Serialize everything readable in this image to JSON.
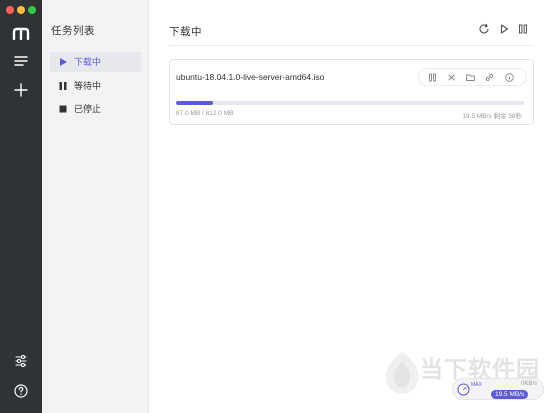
{
  "window": {
    "controls": [
      "close",
      "minimize",
      "maximize"
    ]
  },
  "rail": {
    "icons": [
      "app-logo-icon",
      "menu-icon",
      "add-icon",
      "preferences-icon",
      "help-icon"
    ]
  },
  "categories": {
    "title": "任务列表",
    "items": [
      {
        "label": "下载中",
        "icon": "play-icon",
        "active": true
      },
      {
        "label": "等待中",
        "icon": "pause-icon",
        "active": false
      },
      {
        "label": "已停止",
        "icon": "stop-icon",
        "active": false
      }
    ]
  },
  "main": {
    "title": "下载中",
    "header_actions": [
      "refresh-icon",
      "resume-all-icon",
      "pause-all-icon"
    ]
  },
  "task": {
    "name": "ubuntu-18.04.1.0-live-server-amd64.iso",
    "progress": 0.107,
    "size": "87.0 MB / 812.0 MB",
    "speed_remaining": "19.5 MB/s 剩余 38秒",
    "actions": [
      "pause-icon",
      "delete-icon",
      "folder-icon",
      "link-icon",
      "info-icon"
    ]
  },
  "speed_bubble": {
    "up_label": "MAX",
    "up": "0KB/s",
    "down": "19.5 MB/s"
  },
  "watermark": {
    "text": "当下软件园"
  },
  "colors": {
    "accent": "#5b5bd6",
    "rail": "#303336",
    "sidebar": "#f3f3f3"
  }
}
